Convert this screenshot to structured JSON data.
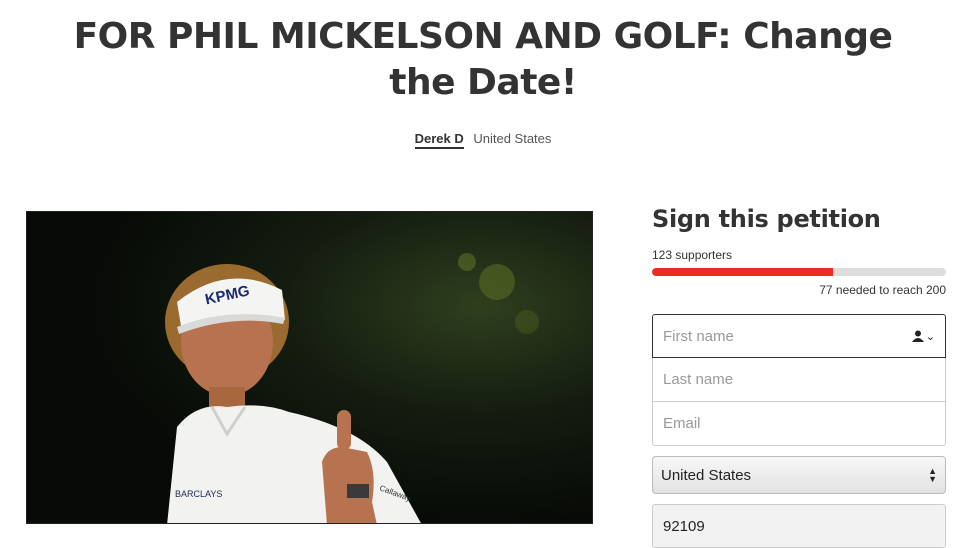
{
  "title": "FOR PHIL MICKELSON AND GOLF: Change the Date!",
  "byline": {
    "author": "Derek D",
    "location": "United States"
  },
  "photo": {
    "visor_text": "KPMG",
    "shirt_text": "BARCLAYS",
    "sleeve_text": "Callaway"
  },
  "sign": {
    "heading": "Sign this petition",
    "supporters": "123 supporters",
    "progress": 0.615,
    "needed": "77 needed to reach 200"
  },
  "form": {
    "first_name_placeholder": "First name",
    "last_name_placeholder": "Last name",
    "email_placeholder": "Email",
    "country": "United States",
    "zip": "92109"
  },
  "colors": {
    "accent": "#ec2c22",
    "text": "#333333"
  }
}
